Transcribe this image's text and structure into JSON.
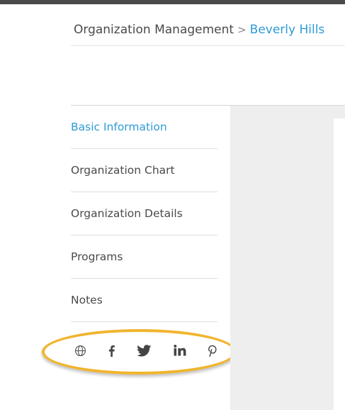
{
  "breadcrumb": {
    "root": "Organization Management",
    "separator": ">",
    "current": "Beverly Hills"
  },
  "sidebar": {
    "items": [
      {
        "label": "Basic Information",
        "active": true
      },
      {
        "label": "Organization Chart",
        "active": false
      },
      {
        "label": "Organization Details",
        "active": false
      },
      {
        "label": "Programs",
        "active": false
      },
      {
        "label": "Notes",
        "active": false
      }
    ]
  },
  "social_links": [
    {
      "icon": "globe-icon"
    },
    {
      "icon": "facebook-icon"
    },
    {
      "icon": "twitter-icon"
    },
    {
      "icon": "linkedin-icon"
    },
    {
      "icon": "pinterest-icon"
    }
  ],
  "colors": {
    "accent": "#2f9bd6",
    "text": "#4a4a4a",
    "highlight": "#f0b52d",
    "content_bg": "#eeeeee"
  }
}
